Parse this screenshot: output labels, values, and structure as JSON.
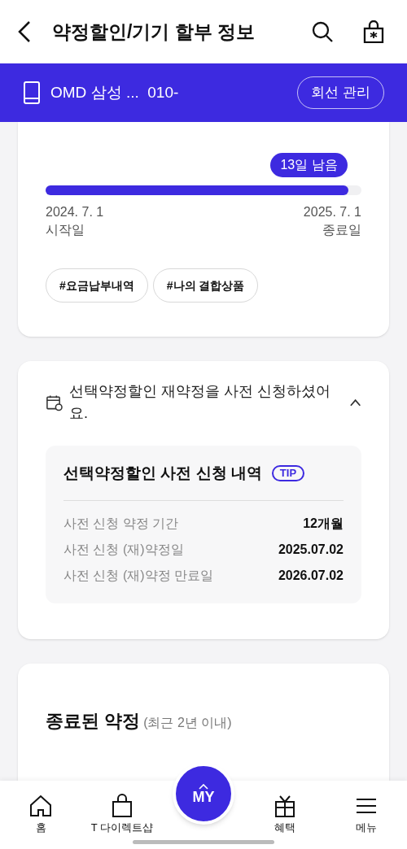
{
  "header": {
    "title": "약정할인/기기 할부 정보"
  },
  "line_bar": {
    "device": "OMD 삼성 ...  010-",
    "button": "회선 관리"
  },
  "contract": {
    "remaining": "13일 남음",
    "level": 0.96,
    "start_date": "2024. 7. 1",
    "start_label": "시작일",
    "end_date": "2025. 7. 1",
    "end_label": "종료일",
    "tags": [
      "#요금납부내역",
      "#나의 결합상품"
    ]
  },
  "renewal": {
    "notice": "선택약정할인 재약정을 사전 신청하셨어요.",
    "expanded": true,
    "title": "선택약정할인 사전 신청 내역",
    "badge": "TIP",
    "rows": [
      {
        "label": "사전 신청 약정 기간",
        "value": "12개월"
      },
      {
        "label": "사전 신청 (재)약정일",
        "value": "2025.07.02"
      },
      {
        "label": "사전 신청 (재)약정 만료일",
        "value": "2026.07.02"
      }
    ]
  },
  "ended": {
    "title": "종료된 약정",
    "note": "(최근 2년 이내)"
  },
  "bottom_nav": [
    {
      "kind": "home",
      "label": "홈"
    },
    {
      "kind": "shop",
      "label": "T 다이렉트샵"
    },
    {
      "kind": "my",
      "label": "MY"
    },
    {
      "kind": "gift",
      "label": "혜택"
    },
    {
      "kind": "menu",
      "label": "메뉴"
    }
  ]
}
